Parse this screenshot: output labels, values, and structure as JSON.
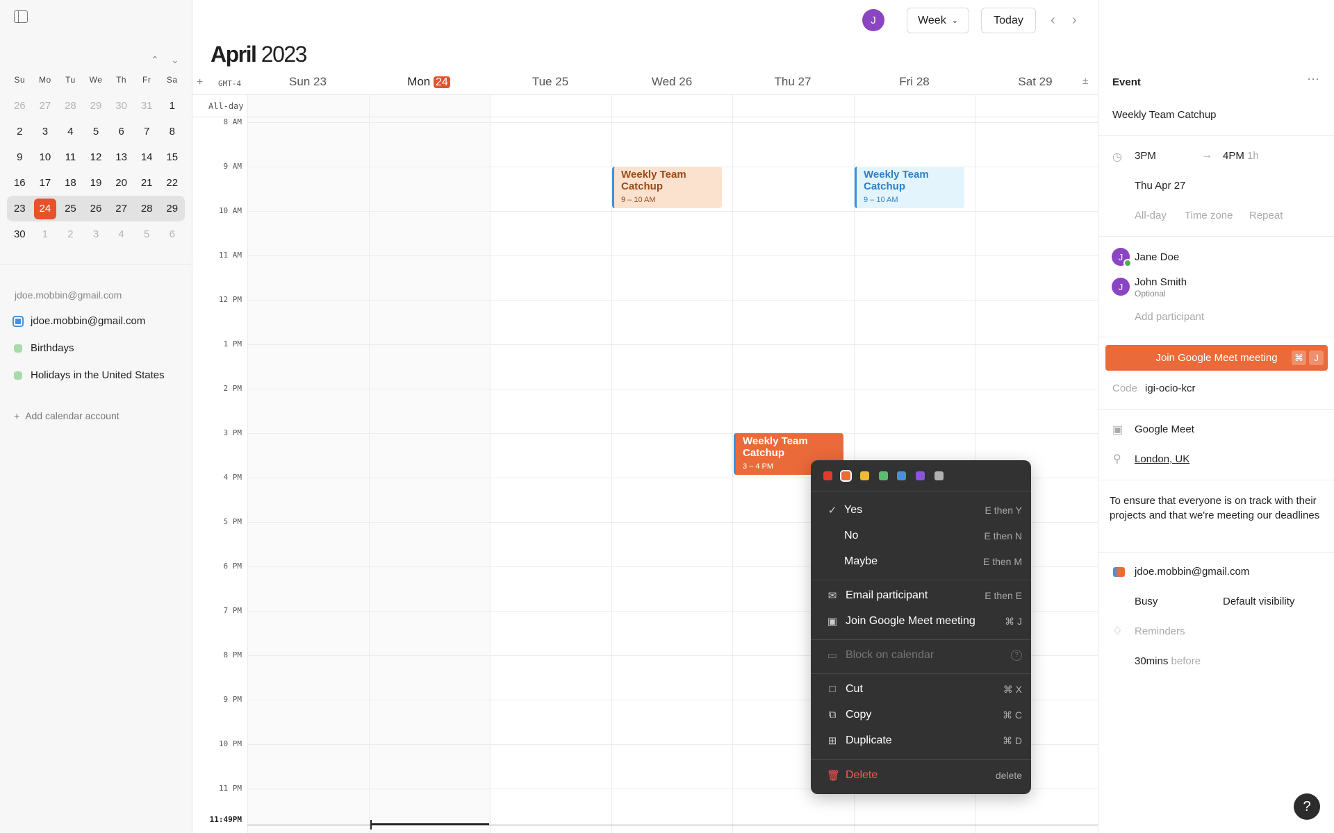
{
  "colors": {
    "accent": "#e8522b",
    "event_orange": "#ea6a3a",
    "event_peach": "#fbe2cf",
    "event_blue": "#e3f4fc",
    "avatar": "#8a45c2"
  },
  "topbar": {
    "avatar_initial": "J",
    "view_label": "Week",
    "today_label": "Today"
  },
  "month_title": {
    "month": "April",
    "year": "2023"
  },
  "mini_calendar": {
    "weekdays": [
      "Su",
      "Mo",
      "Tu",
      "We",
      "Th",
      "Fr",
      "Sa"
    ],
    "weeks": [
      [
        "26",
        "27",
        "28",
        "29",
        "30",
        "31",
        "1"
      ],
      [
        "2",
        "3",
        "4",
        "5",
        "6",
        "7",
        "8"
      ],
      [
        "9",
        "10",
        "11",
        "12",
        "13",
        "14",
        "15"
      ],
      [
        "16",
        "17",
        "18",
        "19",
        "20",
        "21",
        "22"
      ],
      [
        "23",
        "24",
        "25",
        "26",
        "27",
        "28",
        "29"
      ],
      [
        "30",
        "1",
        "2",
        "3",
        "4",
        "5",
        "6"
      ]
    ]
  },
  "sidebar": {
    "account_header": "jdoe.mobbin@gmail.com",
    "calendars": [
      {
        "label": "jdoe.mobbin@gmail.com",
        "color": "#4a90d9"
      },
      {
        "label": "Birthdays",
        "color": "#7bc47f"
      },
      {
        "label": "Holidays in the United States",
        "color": "#7bc47f"
      }
    ],
    "add_account": "Add calendar account"
  },
  "week": {
    "add_symbol": "+",
    "timezone": "GMT-4",
    "days": [
      {
        "name": "Sun",
        "num": "23"
      },
      {
        "name": "Mon",
        "num": "24"
      },
      {
        "name": "Tue",
        "num": "25"
      },
      {
        "name": "Wed",
        "num": "26"
      },
      {
        "name": "Thu",
        "num": "27"
      },
      {
        "name": "Fri",
        "num": "28"
      },
      {
        "name": "Sat",
        "num": "29"
      }
    ],
    "allday_label": "All-day",
    "hours": [
      "8 AM",
      "9 AM",
      "10 AM",
      "11 AM",
      "12 PM",
      "1 PM",
      "2 PM",
      "3 PM",
      "4 PM",
      "5 PM",
      "6 PM",
      "7 PM",
      "8 PM",
      "9 PM",
      "10 PM",
      "11 PM"
    ],
    "now_label": "11:49PM"
  },
  "events": [
    {
      "title": "Weekly Team Catchup",
      "time": "9 – 10 AM",
      "day": 3
    },
    {
      "title": "Weekly Team Catchup",
      "time": "9 – 10 AM",
      "day": 5
    },
    {
      "title": "Weekly Team Catchup",
      "time": "3 – 4 PM",
      "day": 4
    }
  ],
  "panel": {
    "header": "Event",
    "title": "Weekly Team Catchup",
    "start": "3PM",
    "end": "4PM",
    "duration": "1h",
    "date": "Thu Apr 27",
    "options": [
      "All-day",
      "Time zone",
      "Repeat"
    ],
    "participants": [
      {
        "initial": "J",
        "name": "Jane Doe",
        "note": ""
      },
      {
        "initial": "J",
        "name": "John Smith",
        "note": "Optional"
      }
    ],
    "add_participant": "Add participant",
    "join_label": "Join Google Meet meeting",
    "join_kbd": [
      "⌘",
      "J"
    ],
    "code_label": "Code",
    "code_value": "igi-ocio-kcr",
    "conference": "Google Meet",
    "location": "London, UK",
    "description": "To ensure that everyone is on track with their projects and that we're meeting our deadlines",
    "calendar": "jdoe.mobbin@gmail.com",
    "busy": "Busy",
    "visibility": "Default visibility",
    "reminders_label": "Reminders",
    "reminder_value": "30mins",
    "reminder_suffix": "before"
  },
  "context_menu": {
    "swatches": [
      "#e03b2f",
      "#ea6a3a",
      "#f0b93a",
      "#5bbd72",
      "#4a90d9",
      "#8a55d8",
      "#b0b0b0"
    ],
    "rsvp": [
      {
        "label": "Yes",
        "shortcut": "E then Y",
        "checked": true
      },
      {
        "label": "No",
        "shortcut": "E then N"
      },
      {
        "label": "Maybe",
        "shortcut": "E then M"
      }
    ],
    "actions": [
      {
        "label": "Email participant",
        "shortcut": "E then E",
        "icon": "mail-icon"
      },
      {
        "label": "Join Google Meet meeting",
        "shortcut": "⌘ J",
        "icon": "video-icon"
      }
    ],
    "block_label": "Block on calendar",
    "edit": [
      {
        "label": "Cut",
        "shortcut": "⌘ X",
        "icon": "cut-icon"
      },
      {
        "label": "Copy",
        "shortcut": "⌘ C",
        "icon": "copy-icon"
      },
      {
        "label": "Duplicate",
        "shortcut": "⌘ D",
        "icon": "duplicate-icon"
      }
    ],
    "delete_label": "Delete",
    "delete_shortcut": "delete"
  },
  "help_label": "?"
}
